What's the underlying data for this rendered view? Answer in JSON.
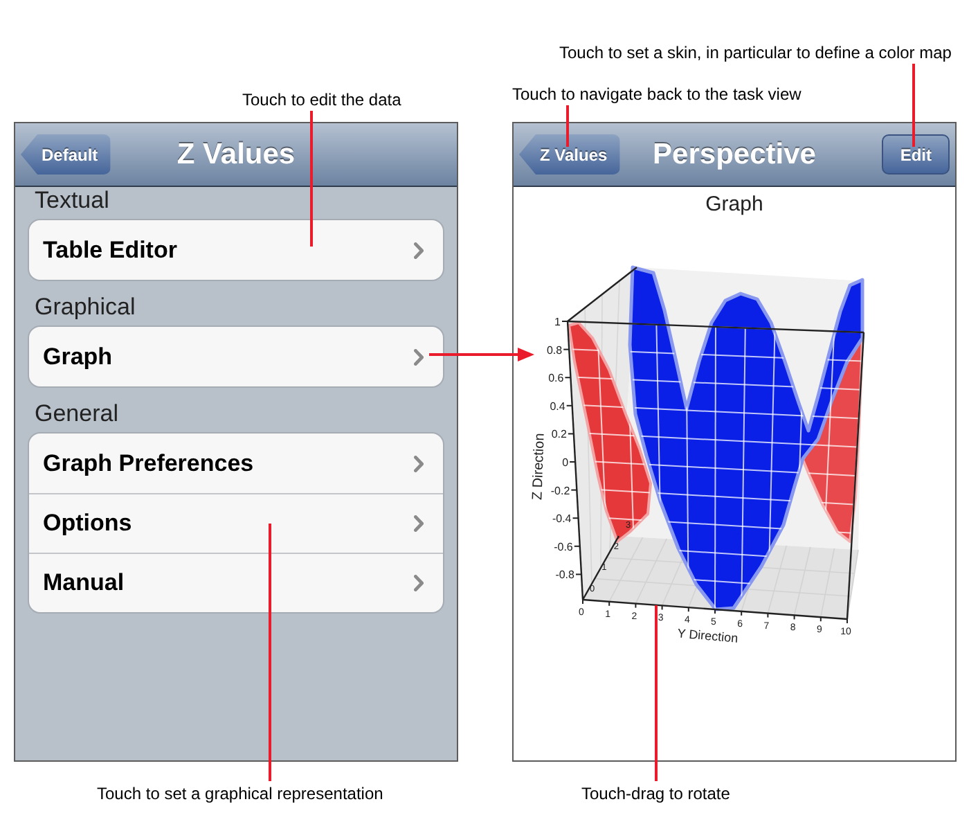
{
  "left_screen": {
    "nav_bar": {
      "back_button": "Default",
      "title": "Z Values"
    },
    "sections": [
      {
        "header": "Textual",
        "rows": [
          "Table Editor"
        ]
      },
      {
        "header": "Graphical",
        "rows": [
          "Graph"
        ]
      },
      {
        "header": "General",
        "rows": [
          "Graph Preferences",
          "Options",
          "Manual"
        ]
      }
    ]
  },
  "right_screen": {
    "nav_bar": {
      "back_button": "Z Values",
      "title": "Perspective",
      "edit_button": "Edit"
    },
    "graph": {
      "title": "Graph",
      "z_axis": {
        "title": "Z Direction",
        "ticks": [
          "1",
          "0.8",
          "0.6",
          "0.4",
          "0.2",
          "0",
          "-0.2",
          "-0.4",
          "-0.6",
          "-0.8"
        ]
      },
      "y_axis": {
        "title": "Y Direction",
        "ticks": [
          "0",
          "1",
          "2",
          "3",
          "4",
          "5",
          "6",
          "7",
          "8",
          "9",
          "10"
        ]
      },
      "x_axis": {
        "ticks": [
          "0",
          "1",
          "2",
          "3"
        ]
      }
    }
  },
  "annotations": [
    "Touch to set a skin, in particular to define a color map",
    "Touch to edit the data",
    "Touch to navigate back to the task view",
    "Touch to set a graphical representation",
    "Touch-drag to rotate"
  ]
}
